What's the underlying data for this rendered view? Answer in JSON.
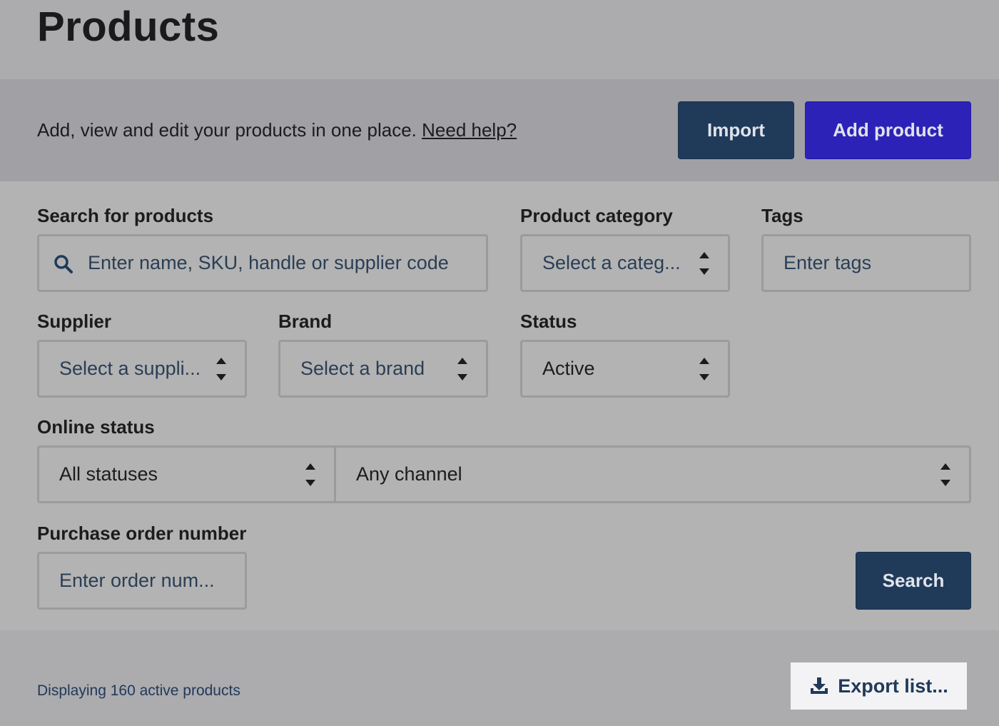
{
  "header": {
    "title": "Products"
  },
  "info_bar": {
    "description": "Add, view and edit your products in one place.",
    "help_link": "Need help?",
    "import_label": "Import",
    "add_product_label": "Add product"
  },
  "filters": {
    "search": {
      "label": "Search for products",
      "placeholder": "Enter name, SKU, handle or supplier code",
      "icon": "search-icon"
    },
    "category": {
      "label": "Product category",
      "placeholder": "Select a categ..."
    },
    "tags": {
      "label": "Tags",
      "placeholder": "Enter tags"
    },
    "supplier": {
      "label": "Supplier",
      "placeholder": "Select a suppli..."
    },
    "brand": {
      "label": "Brand",
      "placeholder": "Select a brand"
    },
    "status": {
      "label": "Status",
      "value": "Active"
    },
    "online_status": {
      "label": "Online status",
      "status_value": "All statuses",
      "channel_value": "Any channel"
    },
    "purchase_order": {
      "label": "Purchase order number",
      "placeholder": "Enter order num..."
    },
    "search_button_label": "Search"
  },
  "footer": {
    "display_count": "Displaying 160 active products",
    "export_label": "Export list...",
    "export_icon": "download-icon"
  }
}
